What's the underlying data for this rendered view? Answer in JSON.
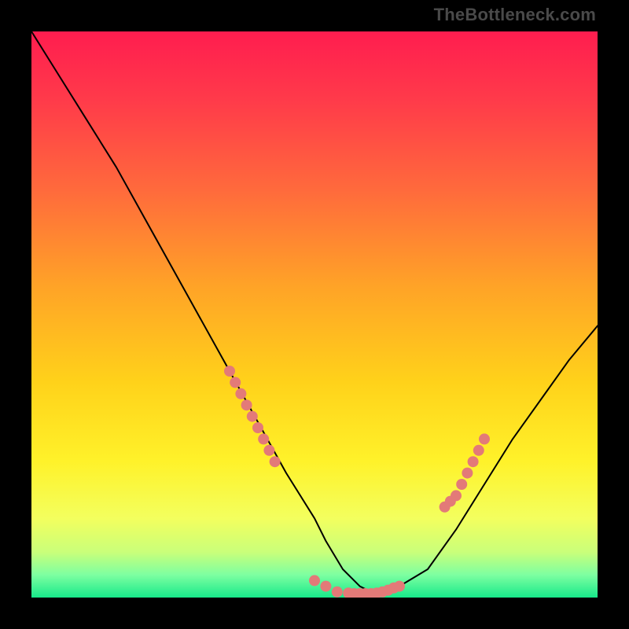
{
  "watermark": "TheBottleneck.com",
  "chart_data": {
    "type": "line",
    "title": "",
    "xlabel": "",
    "ylabel": "",
    "xlim": [
      0,
      100
    ],
    "ylim": [
      0,
      100
    ],
    "background": {
      "type": "vertical_gradient",
      "stops": [
        {
          "offset": 0.0,
          "color": "#ff1d4f"
        },
        {
          "offset": 0.12,
          "color": "#ff3a4a"
        },
        {
          "offset": 0.28,
          "color": "#ff6a3c"
        },
        {
          "offset": 0.45,
          "color": "#ffa327"
        },
        {
          "offset": 0.62,
          "color": "#ffd21a"
        },
        {
          "offset": 0.76,
          "color": "#fff22a"
        },
        {
          "offset": 0.86,
          "color": "#f3ff5e"
        },
        {
          "offset": 0.92,
          "color": "#c9ff7a"
        },
        {
          "offset": 0.96,
          "color": "#7dffa1"
        },
        {
          "offset": 1.0,
          "color": "#17e98a"
        }
      ]
    },
    "series": [
      {
        "name": "bottleneck-curve",
        "color": "#000000",
        "x": [
          0,
          5,
          10,
          15,
          20,
          25,
          30,
          35,
          40,
          45,
          50,
          52,
          55,
          58,
          60,
          62,
          65,
          70,
          75,
          80,
          85,
          90,
          95,
          100
        ],
        "y": [
          100,
          92,
          84,
          76,
          67,
          58,
          49,
          40,
          31,
          22,
          14,
          10,
          5,
          2,
          1,
          1,
          2,
          5,
          12,
          20,
          28,
          35,
          42,
          48
        ]
      },
      {
        "name": "highlight-segment-left",
        "color": "#e37a78",
        "style": "thick-dotted",
        "x": [
          35,
          36,
          37,
          38,
          39,
          40,
          41,
          42,
          43
        ],
        "y": [
          40,
          38,
          36,
          34,
          32,
          30,
          28,
          26,
          24
        ]
      },
      {
        "name": "highlight-segment-valley",
        "color": "#e37a78",
        "style": "thick-dotted",
        "x": [
          50,
          52,
          54,
          56,
          57,
          58,
          59,
          60,
          61,
          62,
          63,
          64,
          65
        ],
        "y": [
          3,
          2,
          1,
          0.8,
          0.7,
          0.7,
          0.7,
          0.7,
          0.8,
          1,
          1.3,
          1.7,
          2
        ]
      },
      {
        "name": "highlight-segment-right",
        "color": "#e37a78",
        "style": "thick-dotted",
        "x": [
          73,
          74,
          75,
          76,
          77,
          78,
          79,
          80
        ],
        "y": [
          16,
          17,
          18,
          20,
          22,
          24,
          26,
          28
        ]
      }
    ]
  }
}
